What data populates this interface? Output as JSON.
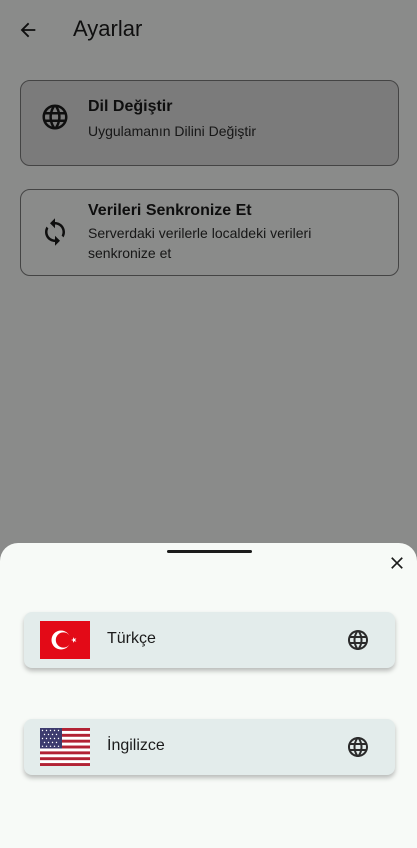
{
  "header": {
    "title": "Ayarlar",
    "back_icon": "arrow-left-icon"
  },
  "settings": [
    {
      "title": "Dil Değiştir",
      "subtitle": "Uygulamanın Dilini Değiştir",
      "icon": "globe-icon"
    },
    {
      "title": "Verileri Senkronize Et",
      "subtitle": "Serverdaki verilerle localdeki verileri senkronize et",
      "icon": "sync-icon"
    }
  ],
  "sheet": {
    "close_icon": "close-icon",
    "languages": [
      {
        "label": "Türkçe",
        "flag": "turkey-flag-icon",
        "icon": "globe-icon"
      },
      {
        "label": "İngilizce",
        "flag": "usa-flag-icon",
        "icon": "globe-icon"
      }
    ]
  },
  "colors": {
    "scrim": "#000000",
    "sheet_bg": "#f7faf7",
    "lang_card_bg": "#e3eceb",
    "turkey_red": "#e30a17"
  }
}
